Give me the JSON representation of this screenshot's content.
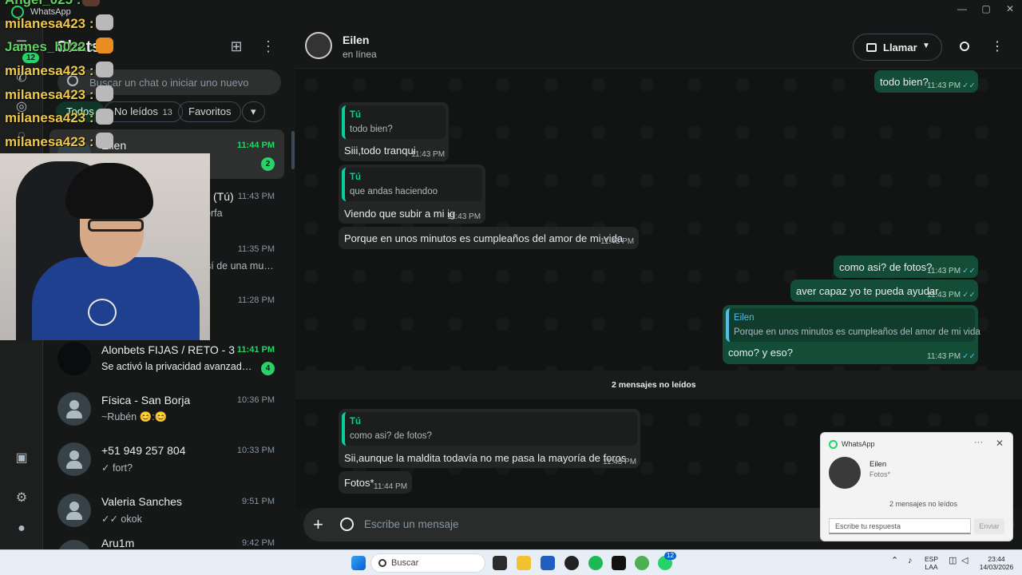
{
  "window": {
    "title": "WhatsApp",
    "controls": [
      "—",
      "▢",
      "✕"
    ]
  },
  "rail": {
    "badge": "12"
  },
  "list": {
    "title": "Chats",
    "search_placeholder": "Buscar un chat o iniciar uno nuevo",
    "filters": [
      {
        "label": "Todos"
      },
      {
        "label": "No leídos",
        "count": "13"
      },
      {
        "label": "Favoritos"
      }
    ],
    "chats": [
      {
        "name": "Eilen",
        "time": "11:44 PM",
        "preview": "",
        "unread": "2"
      },
      {
        "name": "(Tú)",
        "time": "11:43 PM",
        "preview": "orfa",
        "unread": ""
      },
      {
        "name": "",
        "time": "11:35 PM",
        "preview": "sí de una mu…",
        "unread": ""
      },
      {
        "name": "",
        "time": "11:28 PM",
        "preview": "",
        "unread": ""
      },
      {
        "name": "Alonbets FIJAS / RETO - 3",
        "time": "11:41 PM",
        "preview": "Se activó la privacidad avanzada de…",
        "unread": "4"
      },
      {
        "name": "Física - San Borja",
        "time": "10:36 PM",
        "preview": "~Rubén 😊:😊",
        "unread": ""
      },
      {
        "name": "+51 949 257 804",
        "time": "10:33 PM",
        "preview": "✓ fort?",
        "unread": ""
      },
      {
        "name": "Valeria Sanches",
        "time": "9:51 PM",
        "preview": "✓✓ okok",
        "unread": ""
      },
      {
        "name": "Aru1m",
        "time": "9:42 PM",
        "preview": "",
        "unread": ""
      }
    ]
  },
  "stream_chat": [
    {
      "user": "Angel_025",
      "text": ":"
    },
    {
      "user": "milanesa423",
      "text": ":"
    },
    {
      "user": "James_h022",
      "text": ":"
    },
    {
      "user": "milanesa423",
      "text": ":"
    },
    {
      "user": "milanesa423",
      "text": ":"
    },
    {
      "user": "milanesa423",
      "text": ":"
    },
    {
      "user": "milanesa423",
      "text": ":"
    }
  ],
  "conversation": {
    "contact": "Eilen",
    "status": "en línea",
    "call_label": "Llamar",
    "messages": [
      {
        "dir": "out",
        "text": "todo bien?",
        "time": "11:43 PM"
      },
      {
        "dir": "in",
        "quote_name": "Tú",
        "quote_text": "todo bien?",
        "text": "Siii,todo tranqui",
        "time": "11:43 PM"
      },
      {
        "dir": "in",
        "quote_name": "Tú",
        "quote_text": "que andas haciendoo",
        "text": "Viendo que subir a mi ig",
        "time": "11:43 PM"
      },
      {
        "dir": "in",
        "text": "Porque en unos minutos es cumpleaños del amor de mi vida",
        "time": "11:43 PM"
      },
      {
        "dir": "out",
        "text": "como asi? de fotos?",
        "time": "11:43 PM"
      },
      {
        "dir": "out",
        "text": "aver capaz yo te pueda ayudar",
        "time": "11:43 PM"
      },
      {
        "dir": "out",
        "quote_name": "Eilen",
        "quote_text": "Porque en unos minutos es cumpleaños del amor de mi vida",
        "text": "como? y eso?",
        "time": "11:43 PM"
      },
      {
        "dir": "in",
        "quote_name": "Tú",
        "quote_text": "como asi? de fotos?",
        "text": "Sii,aunque la maldita todavía no me pasa la mayoría de foros",
        "time": "11:43 PM"
      },
      {
        "dir": "in",
        "text": "Fotos*",
        "time": "11:44 PM"
      }
    ],
    "unread_separator": "2 mensajes no leídos",
    "composer_placeholder": "Escribe un mensaje"
  },
  "toast": {
    "app": "WhatsApp",
    "sender": "Eilen",
    "message": "Fotos*",
    "unread": "2 mensajes no leídos",
    "reply_placeholder": "Escribe tu respuesta",
    "send_label": "Enviar"
  },
  "taskbar": {
    "search_placeholder": "Buscar",
    "badge": "12",
    "lang_top": "ESP",
    "lang_bottom": "LAA",
    "clock_time": "23:44",
    "clock_date": "14/03/2026"
  },
  "colors": {
    "accent": "#25d366",
    "outgoing": "#144d37",
    "incoming": "#242626"
  }
}
